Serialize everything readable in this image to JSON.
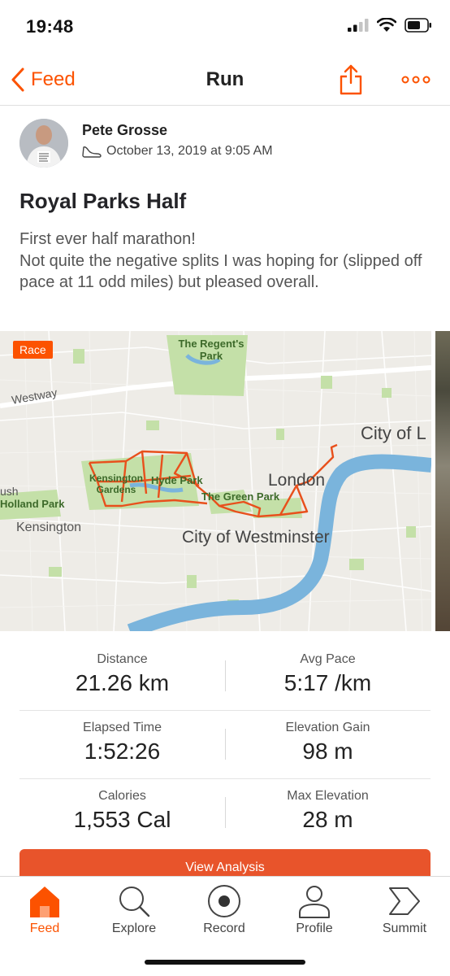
{
  "status_bar": {
    "time": "19:48"
  },
  "nav": {
    "back_label": "Feed",
    "title": "Run"
  },
  "athlete": {
    "name": "Pete Grosse",
    "date": "October 13, 2019 at 9:05 AM"
  },
  "activity": {
    "title": "Royal Parks Half",
    "description": "First ever half marathon!\nNot quite the negative splits I was hoping for (slipped off pace at 11 odd miles) but pleased overall."
  },
  "map": {
    "badge": "Race",
    "labels": {
      "regents_park": "The Regent's Park",
      "westway": "Westway",
      "city_of_london": "City of L",
      "kensington_gardens": "Kensington Gardens",
      "hyde_park": "Hyde Park",
      "green_park": "The Green Park",
      "london": "London",
      "bush": "ush",
      "holland_park": "Holland Park",
      "kensington": "Kensington",
      "westminster": "City of Westminster"
    }
  },
  "stats": [
    {
      "left": {
        "label": "Distance",
        "value": "21.26 km"
      },
      "right": {
        "label": "Avg Pace",
        "value": "5:17 /km"
      }
    },
    {
      "left": {
        "label": "Elapsed Time",
        "value": "1:52:26"
      },
      "right": {
        "label": "Elevation Gain",
        "value": "98 m"
      }
    },
    {
      "left": {
        "label": "Calories",
        "value": "1,553 Cal"
      },
      "right": {
        "label": "Max Elevation",
        "value": "28 m"
      }
    }
  ],
  "analysis_button": "View Analysis",
  "tabs": [
    {
      "label": "Feed",
      "icon": "home-icon",
      "active": true
    },
    {
      "label": "Explore",
      "icon": "search-icon"
    },
    {
      "label": "Record",
      "icon": "record-icon"
    },
    {
      "label": "Profile",
      "icon": "profile-icon"
    },
    {
      "label": "Summit",
      "icon": "summit-icon"
    }
  ],
  "colors": {
    "accent": "#fc5200",
    "route": "#e8501c",
    "water": "#7ab4dc",
    "park": "#c4e0a8"
  }
}
